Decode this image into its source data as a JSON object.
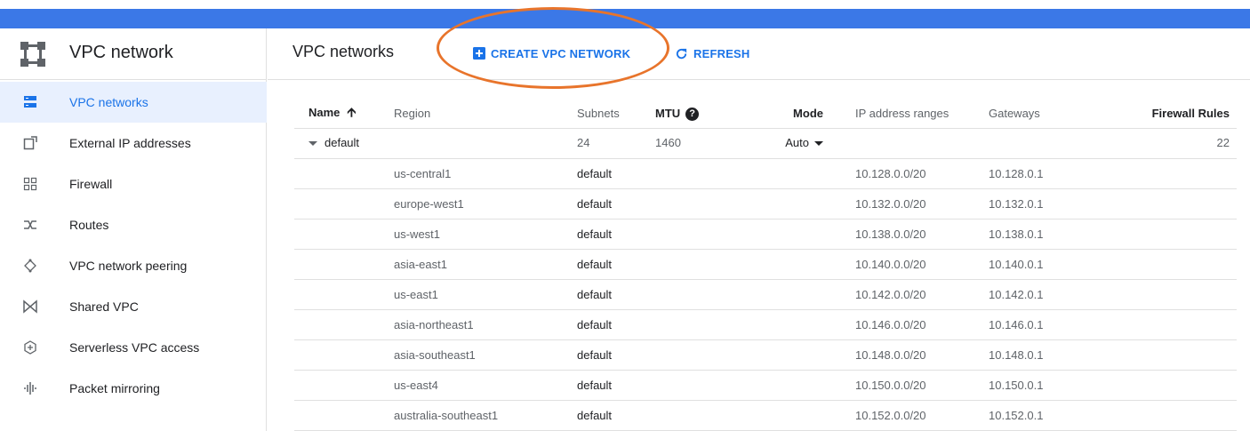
{
  "sidebar": {
    "title": "VPC network",
    "items": [
      {
        "label": "VPC networks",
        "icon": "vpc-networks-icon"
      },
      {
        "label": "External IP addresses",
        "icon": "external-ip-icon"
      },
      {
        "label": "Firewall",
        "icon": "firewall-icon"
      },
      {
        "label": "Routes",
        "icon": "routes-icon"
      },
      {
        "label": "VPC network peering",
        "icon": "peering-icon"
      },
      {
        "label": "Shared VPC",
        "icon": "shared-vpc-icon"
      },
      {
        "label": "Serverless VPC access",
        "icon": "serverless-icon"
      },
      {
        "label": "Packet mirroring",
        "icon": "packet-mirroring-icon"
      }
    ]
  },
  "header": {
    "title": "VPC networks",
    "create_label": "CREATE VPC NETWORK",
    "refresh_label": "REFRESH"
  },
  "table": {
    "columns": {
      "name": "Name",
      "region": "Region",
      "subnets": "Subnets",
      "mtu": "MTU",
      "mode": "Mode",
      "ip": "IP address ranges",
      "gateways": "Gateways",
      "firewall": "Firewall Rules"
    },
    "network": {
      "name": "default",
      "subnets": "24",
      "mtu": "1460",
      "mode": "Auto",
      "firewall_rules": "22"
    },
    "rows": [
      {
        "region": "us-central1",
        "subnet": "default",
        "ip": "10.128.0.0/20",
        "gateway": "10.128.0.1"
      },
      {
        "region": "europe-west1",
        "subnet": "default",
        "ip": "10.132.0.0/20",
        "gateway": "10.132.0.1"
      },
      {
        "region": "us-west1",
        "subnet": "default",
        "ip": "10.138.0.0/20",
        "gateway": "10.138.0.1"
      },
      {
        "region": "asia-east1",
        "subnet": "default",
        "ip": "10.140.0.0/20",
        "gateway": "10.140.0.1"
      },
      {
        "region": "us-east1",
        "subnet": "default",
        "ip": "10.142.0.0/20",
        "gateway": "10.142.0.1"
      },
      {
        "region": "asia-northeast1",
        "subnet": "default",
        "ip": "10.146.0.0/20",
        "gateway": "10.146.0.1"
      },
      {
        "region": "asia-southeast1",
        "subnet": "default",
        "ip": "10.148.0.0/20",
        "gateway": "10.148.0.1"
      },
      {
        "region": "us-east4",
        "subnet": "default",
        "ip": "10.150.0.0/20",
        "gateway": "10.150.0.1"
      },
      {
        "region": "australia-southeast1",
        "subnet": "default",
        "ip": "10.152.0.0/20",
        "gateway": "10.152.0.1"
      }
    ]
  },
  "colors": {
    "accent": "#1a73e8",
    "topbar": "#3b78e7",
    "highlight": "#e8742b",
    "active_bg": "#e8f0fe"
  }
}
